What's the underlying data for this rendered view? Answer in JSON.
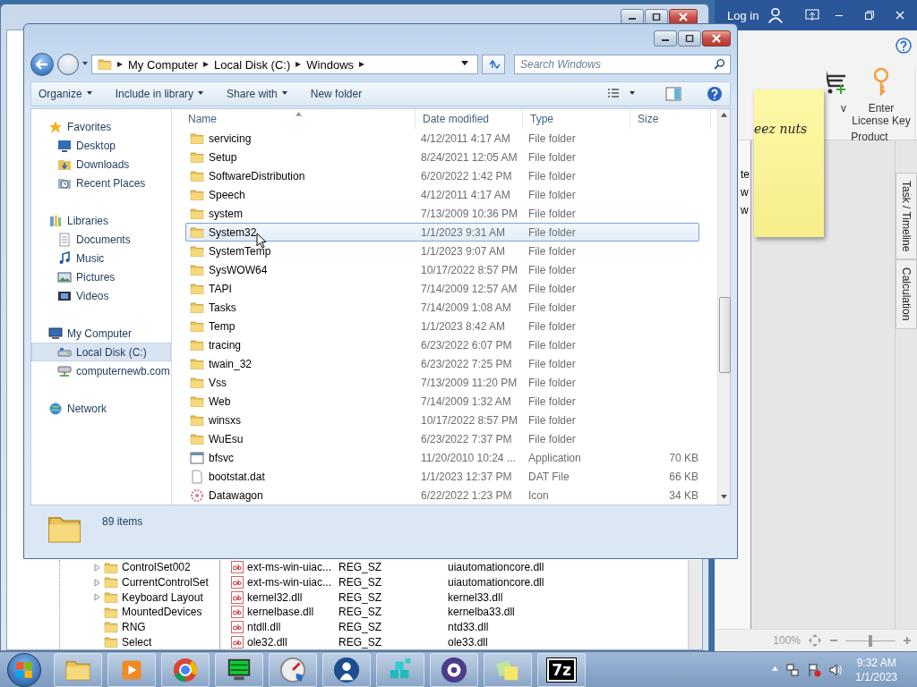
{
  "registry_window": {
    "tree": [
      {
        "label": "ControlSet002",
        "expandable": true
      },
      {
        "label": "CurrentControlSet",
        "expandable": true
      },
      {
        "label": "Keyboard Layout",
        "expandable": true
      },
      {
        "label": "MountedDevices",
        "expandable": false
      },
      {
        "label": "RNG",
        "expandable": false
      },
      {
        "label": "Select",
        "expandable": false
      }
    ],
    "values": [
      {
        "name": "ext-ms-win-uiac...",
        "type": "REG_SZ",
        "data": "uiautomationcore.dll"
      },
      {
        "name": "ext-ms-win-uiac...",
        "type": "REG_SZ",
        "data": "uiautomationcore.dll"
      },
      {
        "name": "kernel32.dll",
        "type": "REG_SZ",
        "data": "kernel33.dll"
      },
      {
        "name": "kernelbase.dll",
        "type": "REG_SZ",
        "data": "kernelba33.dll"
      },
      {
        "name": "ntdll.dll",
        "type": "REG_SZ",
        "data": "ntd33.dll"
      },
      {
        "name": "ole32.dll",
        "type": "REG_SZ",
        "data": "ole33.dll"
      }
    ]
  },
  "app_window": {
    "title_bar": {
      "login": "Log in"
    },
    "ribbon": {
      "buttons": [
        {
          "kind": "cart",
          "label": "v"
        },
        {
          "kind": "key",
          "label": "Enter License Key"
        }
      ],
      "group": "Product"
    },
    "side_panel": {
      "fragments": [
        "te",
        "w",
        "w"
      ]
    },
    "side_tabs": [
      "Task / Timeline",
      "Calculation"
    ],
    "status_bar": {
      "zoom": "100%",
      "zoom_slider": {
        "level": 0.5
      }
    }
  },
  "sticky_note": {
    "text": "eez nuts"
  },
  "explorer": {
    "address": {
      "crumbs": [
        "My Computer",
        "Local Disk (C:)",
        "Windows"
      ]
    },
    "search": {
      "placeholder": "Search Windows"
    },
    "toolbar": [
      {
        "label": "Organize",
        "dropdown": true
      },
      {
        "label": "Include in library",
        "dropdown": true
      },
      {
        "label": "Share with",
        "dropdown": true
      },
      {
        "label": "New folder",
        "dropdown": false
      }
    ],
    "nav_pane": [
      {
        "label": "Favorites",
        "kind": "star",
        "selected": false,
        "children": [
          {
            "label": "Desktop",
            "kind": "desktop",
            "selected": false
          },
          {
            "label": "Downloads",
            "kind": "downloads",
            "selected": false
          },
          {
            "label": "Recent Places",
            "kind": "recent",
            "selected": false
          }
        ]
      },
      {
        "label": "Libraries",
        "kind": "library",
        "selected": false,
        "children": [
          {
            "label": "Documents",
            "kind": "documents",
            "selected": false
          },
          {
            "label": "Music",
            "kind": "music",
            "selected": false
          },
          {
            "label": "Pictures",
            "kind": "pictures",
            "selected": false
          },
          {
            "label": "Videos",
            "kind": "videos",
            "selected": false
          }
        ]
      },
      {
        "label": "My Computer",
        "kind": "computer",
        "selected": false,
        "children": [
          {
            "label": "Local Disk (C:)",
            "kind": "disk",
            "selected": true
          },
          {
            "label": "computernewb.com",
            "kind": "netdrive",
            "selected": false
          }
        ]
      },
      {
        "label": "Network",
        "kind": "network",
        "selected": false
      }
    ],
    "columns": [
      "Name",
      "Date modified",
      "Type",
      "Size"
    ],
    "files": [
      {
        "name": "servicing",
        "date": "4/12/2011 4:17 AM",
        "type": "File folder",
        "kind": "folder",
        "selected": false
      },
      {
        "name": "Setup",
        "date": "8/24/2021 12:05 AM",
        "type": "File folder",
        "kind": "folder",
        "selected": false
      },
      {
        "name": "SoftwareDistribution",
        "date": "6/20/2022 1:42 PM",
        "type": "File folder",
        "kind": "folder",
        "selected": false
      },
      {
        "name": "Speech",
        "date": "4/12/2011 4:17 AM",
        "type": "File folder",
        "kind": "folder",
        "selected": false
      },
      {
        "name": "system",
        "date": "7/13/2009 10:36 PM",
        "type": "File folder",
        "kind": "folder",
        "selected": false
      },
      {
        "name": "System32",
        "date": "1/1/2023 9:31 AM",
        "type": "File folder",
        "kind": "folder",
        "selected": true
      },
      {
        "name": "SystemTemp",
        "date": "1/1/2023 9:07 AM",
        "type": "File folder",
        "kind": "folder",
        "selected": false
      },
      {
        "name": "SysWOW64",
        "date": "10/17/2022 8:57 PM",
        "type": "File folder",
        "kind": "folder",
        "selected": false
      },
      {
        "name": "TAPI",
        "date": "7/14/2009 12:57 AM",
        "type": "File folder",
        "kind": "folder",
        "selected": false
      },
      {
        "name": "Tasks",
        "date": "7/14/2009 1:08 AM",
        "type": "File folder",
        "kind": "folder",
        "selected": false
      },
      {
        "name": "Temp",
        "date": "1/1/2023 8:42 AM",
        "type": "File folder",
        "kind": "folder",
        "selected": false
      },
      {
        "name": "tracing",
        "date": "6/23/2022 6:07 PM",
        "type": "File folder",
        "kind": "folder",
        "selected": false
      },
      {
        "name": "twain_32",
        "date": "6/23/2022 7:25 PM",
        "type": "File folder",
        "kind": "folder",
        "selected": false
      },
      {
        "name": "Vss",
        "date": "7/13/2009 11:20 PM",
        "type": "File folder",
        "kind": "folder",
        "selected": false
      },
      {
        "name": "Web",
        "date": "7/14/2009 1:32 AM",
        "type": "File folder",
        "kind": "folder",
        "selected": false
      },
      {
        "name": "winsxs",
        "date": "10/17/2022 8:57 PM",
        "type": "File folder",
        "kind": "folder",
        "selected": false
      },
      {
        "name": "WuEsu",
        "date": "6/23/2022 7:37 PM",
        "type": "File folder",
        "kind": "folder",
        "selected": false
      },
      {
        "name": "bfsvc",
        "date": "11/20/2010 10:24 ...",
        "type": "Application",
        "size": "70 KB",
        "kind": "application",
        "selected": false
      },
      {
        "name": "bootstat.dat",
        "date": "1/1/2023 12:37 PM",
        "type": "DAT File",
        "size": "66 KB",
        "kind": "file",
        "selected": false
      },
      {
        "name": "Datawagon",
        "date": "6/22/2022 1:23 PM",
        "type": "Icon",
        "size": "34 KB",
        "kind": "icon",
        "selected": false
      }
    ],
    "status": "89 items"
  },
  "taskbar": {
    "items": [
      {
        "kind": "folder"
      },
      {
        "kind": "player"
      },
      {
        "kind": "browser"
      },
      {
        "kind": "monitor"
      },
      {
        "kind": "gauge"
      },
      {
        "kind": "person"
      },
      {
        "kind": "cubes"
      },
      {
        "kind": "gear"
      },
      {
        "kind": "notes"
      },
      {
        "kind": "text",
        "label": "7z"
      }
    ],
    "time": "9:32 AM",
    "date": "1/1/2023"
  }
}
